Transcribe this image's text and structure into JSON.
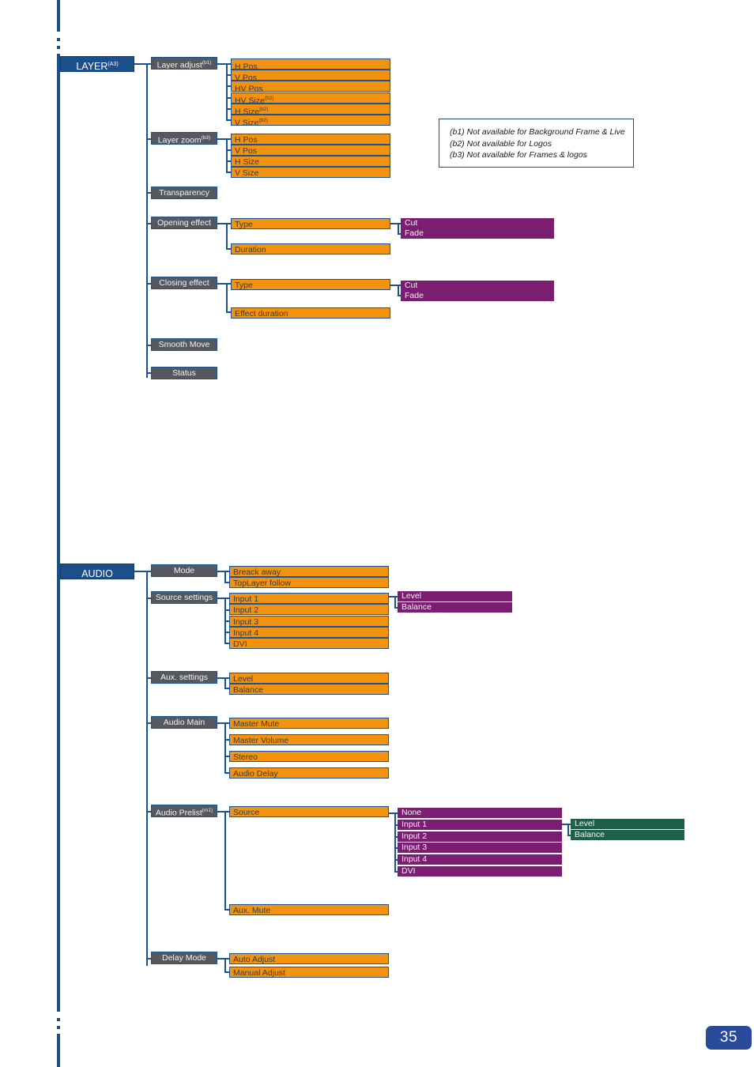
{
  "page": {
    "number": "35"
  },
  "legend": {
    "notes": [
      "(b1) Not available for Background Frame & Live",
      "(b2) Not available for Logos",
      "(b3) Not available for Frames & logos"
    ]
  },
  "menu_tree": {
    "sections": [
      {
        "root": {
          "label": "LAYER",
          "sup": "(A3)"
        },
        "items": [
          {
            "label": "Layer adjust",
            "sup": "(b1)",
            "children": [
              {
                "label": "H Pos",
                "sup": ""
              },
              {
                "label": "V Pos",
                "sup": ""
              },
              {
                "label": "HV Pos",
                "sup": ""
              },
              {
                "label": "HV Size",
                "sup": "(b2)"
              },
              {
                "label": "H Size",
                "sup": "(b2)"
              },
              {
                "label": "V Size",
                "sup": "(b2)"
              }
            ]
          },
          {
            "label": "Layer zoom",
            "sup": "(b3)",
            "children": [
              {
                "label": "H Pos",
                "sup": ""
              },
              {
                "label": "V Pos",
                "sup": ""
              },
              {
                "label": "H Size",
                "sup": ""
              },
              {
                "label": "V Size",
                "sup": ""
              }
            ]
          },
          {
            "label": "Transparency",
            "sup": "",
            "children": []
          },
          {
            "label": "Opening effect",
            "sup": "",
            "children": [
              {
                "label": "Type",
                "sup": "",
                "options": [
                  "Cut",
                  "Fade"
                ]
              },
              {
                "label": "Duration",
                "sup": ""
              }
            ]
          },
          {
            "label": "Closing effect",
            "sup": "",
            "children": [
              {
                "label": "Type",
                "sup": "",
                "options": [
                  "Cut",
                  "Fade"
                ]
              },
              {
                "label": "Effect duration",
                "sup": ""
              }
            ]
          },
          {
            "label": "Smooth Move",
            "sup": "",
            "children": []
          },
          {
            "label": "Status",
            "sup": "",
            "children": []
          }
        ]
      },
      {
        "root": {
          "label": "AUDIO",
          "sup": ""
        },
        "items": [
          {
            "label": "Mode",
            "sup": "",
            "children": [
              {
                "label": "Breack away",
                "sup": ""
              },
              {
                "label": "TopLayer follow",
                "sup": ""
              }
            ]
          },
          {
            "label": "Source settings",
            "sup": "",
            "children": [
              {
                "label": "Input 1",
                "sup": "",
                "options": [
                  "Level",
                  "Balance"
                ]
              },
              {
                "label": "Input 2",
                "sup": ""
              },
              {
                "label": "Input 3",
                "sup": ""
              },
              {
                "label": "Input 4",
                "sup": ""
              },
              {
                "label": "DVI",
                "sup": ""
              }
            ]
          },
          {
            "label": "Aux. settings",
            "sup": "",
            "children": [
              {
                "label": "Level",
                "sup": ""
              },
              {
                "label": "Balance",
                "sup": ""
              }
            ]
          },
          {
            "label": "Audio Main",
            "sup": "",
            "children": [
              {
                "label": "Master Mute",
                "sup": ""
              },
              {
                "label": "Master Volume",
                "sup": ""
              },
              {
                "label": "Stereo",
                "sup": ""
              },
              {
                "label": "Audio Delay",
                "sup": ""
              }
            ]
          },
          {
            "label": "Audio Prelist",
            "sup": "(m1)",
            "children": [
              {
                "label": "Source",
                "sup": "",
                "options": [
                  "None",
                  "Input 1",
                  "Input 2",
                  "Input 3",
                  "Input 4",
                  "DVI"
                ],
                "sub_options": [
                  "Level",
                  "Balance"
                ]
              },
              {
                "label": "Aux. Mute",
                "sup": ""
              }
            ]
          },
          {
            "label": "Delay Mode",
            "sup": "",
            "children": [
              {
                "label": "Auto Adjust",
                "sup": ""
              },
              {
                "label": "Manual Adjust",
                "sup": ""
              }
            ]
          }
        ]
      }
    ]
  }
}
